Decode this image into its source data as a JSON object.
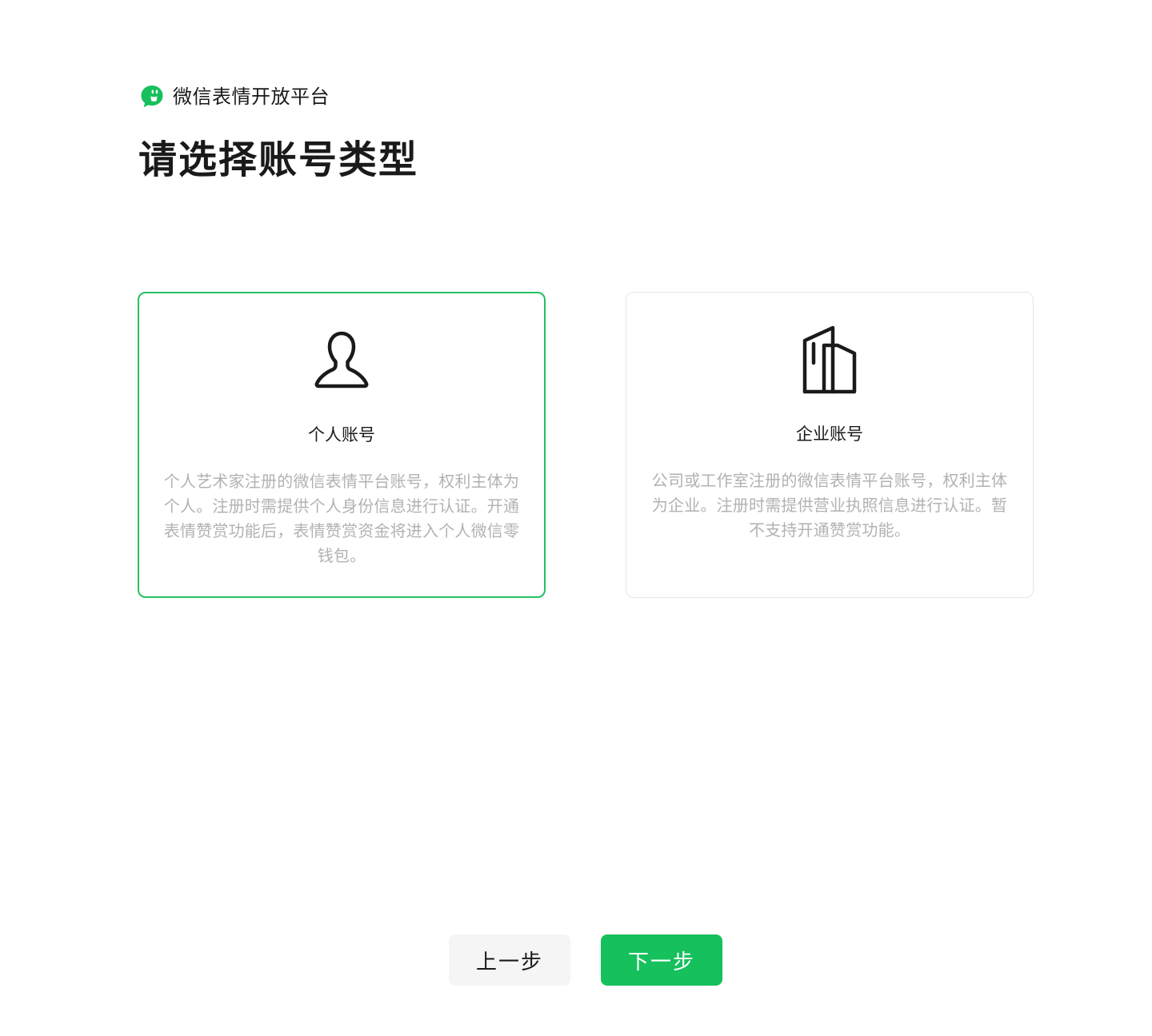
{
  "brand": {
    "name": "微信表情开放平台",
    "icon": "wechat-sticker-logo-icon",
    "color": "#16c05c"
  },
  "page": {
    "title": "请选择账号类型"
  },
  "account_types": [
    {
      "id": "personal",
      "icon": "person-icon",
      "title": "个人账号",
      "description": "个人艺术家注册的微信表情平台账号，权利主体为个人。注册时需提供个人身份信息进行认证。开通表情赞赏功能后，表情赞赏资金将进入个人微信零钱包。",
      "selected": true
    },
    {
      "id": "enterprise",
      "icon": "building-icon",
      "title": "企业账号",
      "description": "公司或工作室注册的微信表情平台账号，权利主体为企业。注册时需提供营业执照信息进行认证。暂不支持开通赞赏功能。",
      "selected": false
    }
  ],
  "actions": {
    "prev_label": "上一步",
    "next_label": "下一步"
  },
  "colors": {
    "accent": "#16c05c",
    "selected_border": "#23c062",
    "card_border": "#e6e6e6",
    "muted_text": "#b2b2b2",
    "secondary_button_bg": "#f5f5f5"
  }
}
